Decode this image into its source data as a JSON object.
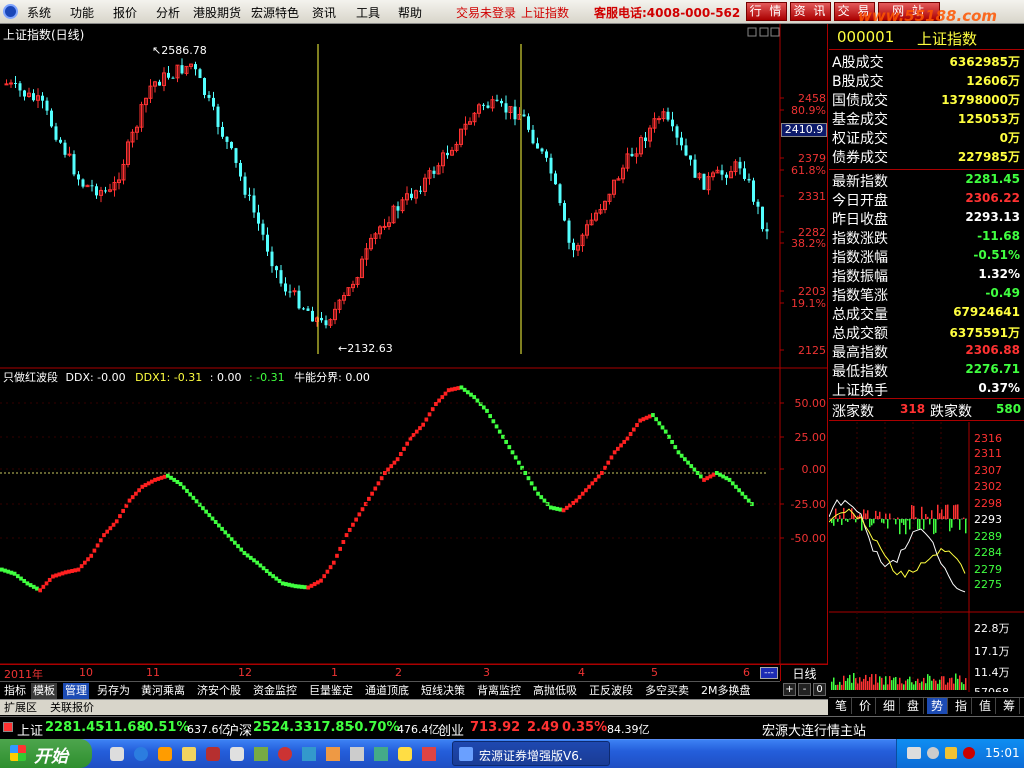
{
  "menubar": {
    "items": [
      "系统",
      "功能",
      "报价",
      "分析",
      "港股期货",
      "宏源特色",
      "资讯",
      "工具",
      "帮助"
    ],
    "status": "交易未登录",
    "index_name": "上证指数",
    "hotline": "客服电话:4008-000-562",
    "nav_buttons": [
      "行 情",
      "资 讯",
      "交 易",
      "网 站"
    ],
    "watermark": "www.55188.com"
  },
  "kline": {
    "title": "上证指数(日线)",
    "high_label": "2586.78",
    "low_label": "2132.63",
    "axis_ticks": [
      {
        "label": "2458",
        "pct": ""
      },
      {
        "label": "80.9%",
        "pct": ""
      },
      {
        "label": "2410.9",
        "pct": ""
      },
      {
        "label": "2379",
        "pct": ""
      },
      {
        "label": "61.8%",
        "pct": ""
      },
      {
        "label": "2331",
        "pct": ""
      },
      {
        "label": "2282",
        "pct": ""
      },
      {
        "label": "38.2%",
        "pct": ""
      },
      {
        "label": "2203",
        "pct": ""
      },
      {
        "label": "19.1%",
        "pct": ""
      },
      {
        "label": "2125",
        "pct": ""
      }
    ],
    "current_price_box": "2410.9",
    "colors": {
      "up": "#ff3232",
      "down": "#54ffff",
      "fib": "#ffff40"
    }
  },
  "indicator": {
    "name": "只做红波段",
    "ddx_label": "DDX: -0.00",
    "ddx1_label": "DDX1: -0.31",
    "val2": ": 0.00",
    "val3": ": -0.31",
    "bull_label": "牛能分界: 0.00",
    "axis": [
      "50.00",
      "25.00",
      "0.00",
      "-25.00",
      "-50.00"
    ],
    "series_values": [
      -70,
      -73,
      -80,
      -85,
      -75,
      -72,
      -70,
      -60,
      -45,
      -35,
      -20,
      -10,
      -5,
      -2,
      -8,
      -18,
      -28,
      -38,
      -48,
      -58,
      -65,
      -73,
      -80,
      -82,
      -83,
      -78,
      -65,
      -45,
      -30,
      -15,
      0,
      10,
      25,
      35,
      50,
      60,
      62,
      55,
      45,
      30,
      15,
      0,
      -15,
      -25,
      -27,
      -20,
      -10,
      0,
      15,
      25,
      38,
      42,
      30,
      15,
      5,
      -5,
      0,
      -5,
      -15,
      -25
    ],
    "bull_colors": {
      "up": "#ff2020",
      "down": "#40ff40"
    }
  },
  "dates": [
    "2011年",
    "10",
    "11",
    "12",
    "1",
    "2",
    "3",
    "4",
    "5",
    "6"
  ],
  "period": "日线",
  "zoom_buttons": [
    "+",
    "-",
    "0"
  ],
  "tabs_row1": [
    "指标",
    "模板",
    "管理",
    "另存为",
    "黄河乘离",
    "济安个股",
    "资金监控",
    "巨量鉴定",
    "通道顶底",
    "短线决策",
    "背离监控",
    "高抛低吸",
    "正反波段",
    "多空买卖",
    "2M多换盘"
  ],
  "tabs_row2": [
    "扩展区",
    "关联报价"
  ],
  "sidebar": {
    "code": "000001",
    "name": "上证指数",
    "volume_rows": [
      {
        "label": "A股成交",
        "value": "6362985万"
      },
      {
        "label": "B股成交",
        "value": "12606万"
      },
      {
        "label": "国债成交",
        "value": "13798000万"
      },
      {
        "label": "基金成交",
        "value": "125053万"
      },
      {
        "label": "权证成交",
        "value": "0万"
      },
      {
        "label": "债券成交",
        "value": "227985万"
      }
    ],
    "quote_rows": [
      {
        "label": "最新指数",
        "value": "2281.45",
        "color": "#40ff40"
      },
      {
        "label": "今日开盘",
        "value": "2306.22",
        "color": "#ff3232"
      },
      {
        "label": "昨日收盘",
        "value": "2293.13",
        "color": "#ffffff"
      },
      {
        "label": "指数涨跌",
        "value": "-11.68",
        "color": "#40ff40"
      },
      {
        "label": "指数涨幅",
        "value": "-0.51%",
        "color": "#40ff40"
      },
      {
        "label": "指数振幅",
        "value": "1.32%",
        "color": "#ffffff"
      },
      {
        "label": "指数笔涨",
        "value": "-0.49",
        "color": "#40ff40"
      },
      {
        "label": "总成交量",
        "value": "67924641",
        "color": "#ffff40"
      },
      {
        "label": "总成交额",
        "value": "6375591万",
        "color": "#ffff40"
      },
      {
        "label": "最高指数",
        "value": "2306.88",
        "color": "#ff3232"
      },
      {
        "label": "最低指数",
        "value": "2276.71",
        "color": "#40ff40"
      },
      {
        "label": "上证换手",
        "value": "0.37%",
        "color": "#ffffff"
      }
    ],
    "up_label": "涨家数",
    "up_count": "318",
    "down_label": "跌家数",
    "down_count": "580",
    "mini_axis": [
      "2316",
      "2311",
      "2307",
      "2302",
      "2298",
      "2293",
      "2289",
      "2284",
      "2279",
      "2275"
    ],
    "vol_axis": [
      "22.8万",
      "17.1万",
      "11.4万",
      "57068"
    ],
    "bottom_tabs": [
      "笔",
      "价",
      "细",
      "盘",
      "势",
      "指",
      "值",
      "筹"
    ]
  },
  "ticker": [
    {
      "name": "上证",
      "price": "2281.45",
      "chg": "-11.68",
      "pct": "-0.51%",
      "amt": "637.6亿"
    },
    {
      "name": "沪深",
      "price": "2524.33",
      "chg": "-17.85",
      "pct": "-0.70%",
      "amt": "476.4亿"
    },
    {
      "name": "创业",
      "price": "713.92",
      "chg": "2.49",
      "pct": "0.35%",
      "amt": "84.39亿"
    }
  ],
  "ticker_right": "宏源大连行情主站",
  "taskbar": {
    "start_label": "开始",
    "window_title": "宏源证券增强版V6.",
    "clock": "15:01"
  }
}
